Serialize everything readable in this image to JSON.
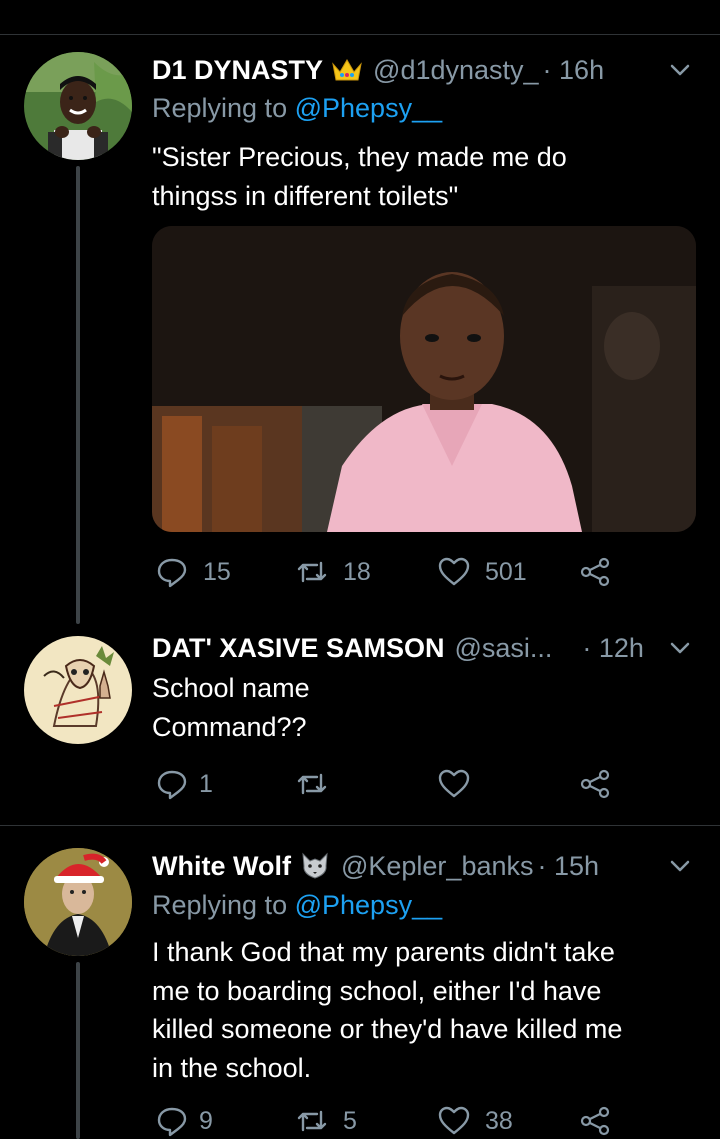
{
  "tweets": [
    {
      "name": "D1 DYNASTY",
      "badge": "crown-emoji",
      "handle": "@d1dynasty_",
      "time": "· 16h",
      "replying_label": "Replying to",
      "replying_to": "@Phepsy__",
      "text_lines": [
        "\"Sister Precious, they made me do",
        "thingss in different toilets\""
      ],
      "media": "photo of a boy in a pink shirt",
      "replies": "15",
      "retweets": "18",
      "likes": "501"
    },
    {
      "name": "DAT' XASIVE SAMSON",
      "handle": "@sasi...",
      "time": "· 12h",
      "text_lines": [
        "School name",
        "Command??"
      ],
      "replies": "1",
      "retweets": "",
      "likes": ""
    },
    {
      "name": "White Wolf",
      "badge": "wolf-emoji",
      "handle": "@Kepler_banks",
      "time": "· 15h",
      "replying_label": "Replying to",
      "replying_to": "@Phepsy__",
      "text_lines": [
        "I thank God that my parents didn't take",
        "me to boarding school, either I'd have",
        "killed someone or they'd have killed me",
        "in the school."
      ],
      "replies": "9",
      "retweets": "5",
      "likes": "38"
    }
  ],
  "colors": {
    "background": "#000000",
    "secondary_text": "#8899a6",
    "mention": "#1da1f2",
    "divider": "#2f3336"
  }
}
